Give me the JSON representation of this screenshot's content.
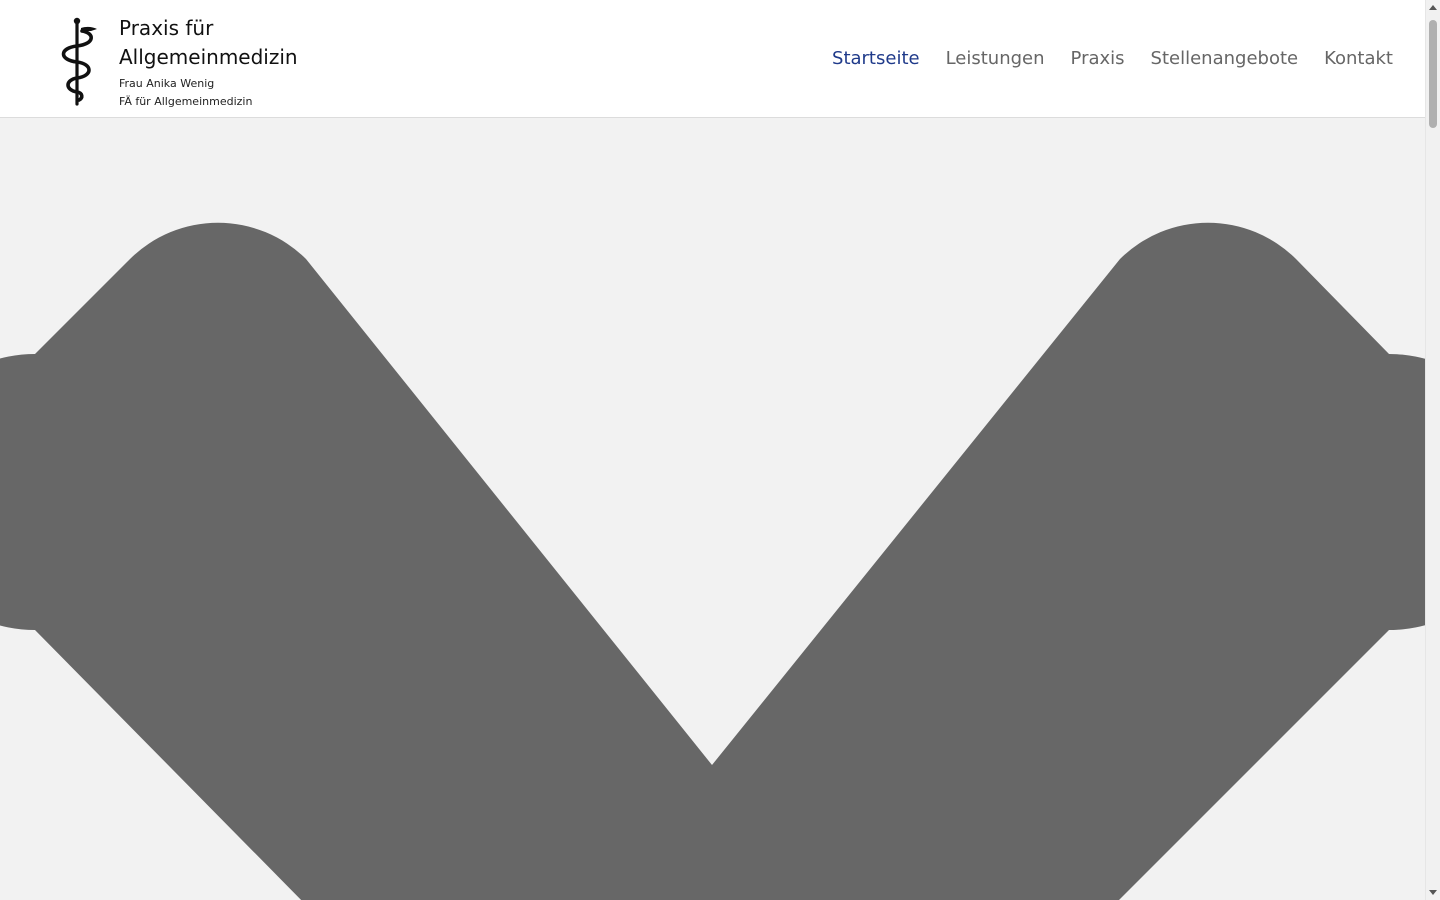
{
  "header": {
    "logo": {
      "title": "Praxis für Allgemeinmedizin",
      "subtitle_1": "Frau Anika Wenig",
      "subtitle_2": "FÄ für Allgemeinmedizin",
      "icon": "rod-of-asclepius-icon"
    },
    "nav": [
      {
        "label": "Startseite",
        "active": true
      },
      {
        "label": "Leistungen",
        "active": false
      },
      {
        "label": "Praxis",
        "active": false
      },
      {
        "label": "Stellenangebote",
        "active": false
      },
      {
        "label": "Kontakt",
        "active": false
      }
    ]
  },
  "hero": {
    "icon": "chevron-down-icon",
    "icon_color": "#676767",
    "background_color": "#f2f2f2"
  },
  "colors": {
    "nav_active": "#1f3a8a",
    "nav_default": "#666666"
  }
}
